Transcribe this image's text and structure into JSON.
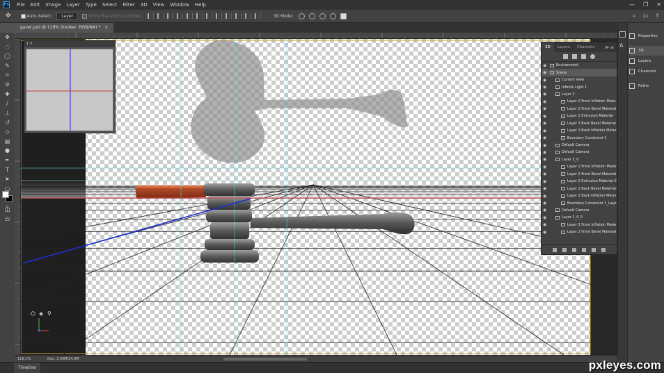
{
  "menubar": {
    "logo": "Ps",
    "items": [
      "File",
      "Edit",
      "Image",
      "Layer",
      "Type",
      "Select",
      "Filter",
      "3D",
      "View",
      "Window",
      "Help"
    ],
    "window_controls": [
      "—",
      "❐",
      "✕"
    ]
  },
  "options": {
    "auto_select_label": "Auto-Select:",
    "auto_select_value": "Layer",
    "show_transform_label": "Show Transform Controls",
    "mode_label": "3D Mode:"
  },
  "document": {
    "tab_title": "gavel.psd @ 118% (knoker, RGB/8#) *",
    "close": "×"
  },
  "navigator": {
    "header": "1 ×"
  },
  "status": {
    "zoom": "118.1%",
    "doc_size": "Doc: 3.00M/24.0M"
  },
  "timeline": {
    "label": "Timeline"
  },
  "watermark": "pxleyes.com",
  "panel3d": {
    "tabs": [
      "3D",
      "Layers",
      "Channels"
    ],
    "items": [
      {
        "label": "Environment",
        "indent": 0
      },
      {
        "label": "Scene",
        "indent": 0,
        "selected": true
      },
      {
        "label": "Current View",
        "indent": 1
      },
      {
        "label": "Infinite Light 1",
        "indent": 1
      },
      {
        "label": "Layer 2",
        "indent": 1
      },
      {
        "label": "Layer 2 Front Inflation Mate...",
        "indent": 2
      },
      {
        "label": "Layer 2 Front Bevel Material",
        "indent": 2
      },
      {
        "label": "Layer 2 Extrusion Material",
        "indent": 2
      },
      {
        "label": "Layer 2 Back Bevel Material",
        "indent": 2
      },
      {
        "label": "Layer 2 Back Inflation Material",
        "indent": 2
      },
      {
        "label": "Boundary Constraint 1",
        "indent": 2
      },
      {
        "label": "Default Camera",
        "indent": 1
      },
      {
        "label": "Default Camera",
        "indent": 1
      },
      {
        "label": "Layer 2_0",
        "indent": 1
      },
      {
        "label": "Layer 2 Front Inflation Mater...",
        "indent": 2
      },
      {
        "label": "Layer 2 Front Bevel Material-0",
        "indent": 2
      },
      {
        "label": "Layer 2 Extrusion Material-0",
        "indent": 2
      },
      {
        "label": "Layer 2 Back Bevel Material-0",
        "indent": 2
      },
      {
        "label": "Layer 2 Back Inflation Materi...",
        "indent": 2
      },
      {
        "label": "Boundary Constraint 1_Laye...",
        "indent": 2
      },
      {
        "label": "Default Camera",
        "indent": 1
      },
      {
        "label": "Layer 2_0_0",
        "indent": 1
      },
      {
        "label": "Layer 2 Front Inflation Mater...",
        "indent": 2
      },
      {
        "label": "Layer 2 Front Bevel Material...",
        "indent": 2
      }
    ]
  },
  "dock": {
    "items": [
      {
        "label": "Properties",
        "icon": "properties-icon"
      },
      {
        "label": "3D",
        "icon": "cube-icon",
        "active": true
      },
      {
        "label": "Layers",
        "icon": "layers-icon"
      },
      {
        "label": "Channels",
        "icon": "channels-icon"
      },
      {
        "label": "Paths",
        "icon": "paths-icon"
      }
    ]
  },
  "tools": [
    "move-tool",
    "marquee-tool",
    "lasso-tool",
    "quick-select-tool",
    "crop-tool",
    "eyedropper-tool",
    "healing-brush-tool",
    "brush-tool",
    "clone-stamp-tool",
    "history-brush-tool",
    "eraser-tool",
    "gradient-tool",
    "dodge-tool",
    "pen-tool",
    "type-tool",
    "path-select-tool",
    "shape-tool",
    "hand-tool",
    "zoom-tool",
    "more-tools"
  ]
}
